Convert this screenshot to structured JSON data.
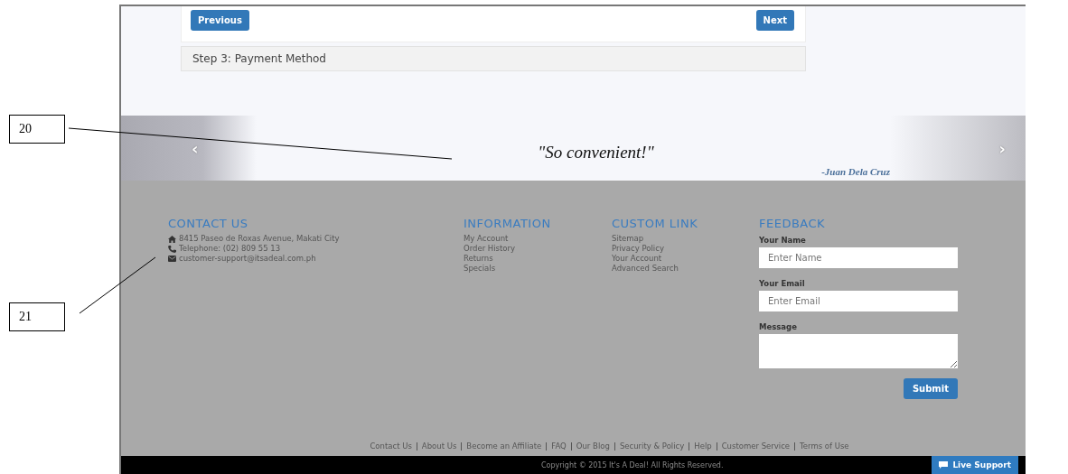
{
  "annotations": [
    {
      "label": "20"
    },
    {
      "label": "21"
    }
  ],
  "wizard": {
    "previous_button": "Previous",
    "next_button": "Next",
    "step": "Step 3: Payment Method"
  },
  "testimonial": {
    "prev_arrow": "‹",
    "quote": "\"So convenient!\"",
    "author": "-Juan Dela Cruz",
    "next_arrow": "›"
  },
  "footer": {
    "contact": {
      "heading": "CONTACT US",
      "lines": [
        {
          "kind": "home",
          "text": "8415 Paseo de Roxas Avenue, Makati City"
        },
        {
          "kind": "phone",
          "text": "Telephone: (02) 809 55 13"
        },
        {
          "kind": "mail",
          "text": "customer-support@itsadeal.com.ph"
        }
      ]
    },
    "information": {
      "heading": "INFORMATION",
      "links": [
        "My Account",
        "Order History",
        "Returns",
        "Specials"
      ]
    },
    "custom_link": {
      "heading": "CUSTOM LINK",
      "links": [
        "Sitemap",
        "Privacy Policy",
        "Your Account",
        "Advanced Search"
      ]
    },
    "feedback": {
      "heading": "FEEDBACK",
      "fields": [
        {
          "kind": "input",
          "label": "Your Name",
          "placeholder": "Enter Name"
        },
        {
          "kind": "input",
          "label": "Your Email",
          "placeholder": "Enter Email"
        },
        {
          "kind": "textarea",
          "label": "Message"
        }
      ],
      "submit": "Submit"
    }
  },
  "bottom_links": [
    "Contact Us",
    "About Us",
    "Become an Affiliate",
    "FAQ",
    "Our Blog",
    "Security & Policy",
    "Help",
    "Customer Service",
    "Terms of Use"
  ],
  "copyright": "Copyright © 2015 It's A Deal! All Rights Reserved.",
  "live_support": "Live Support"
}
